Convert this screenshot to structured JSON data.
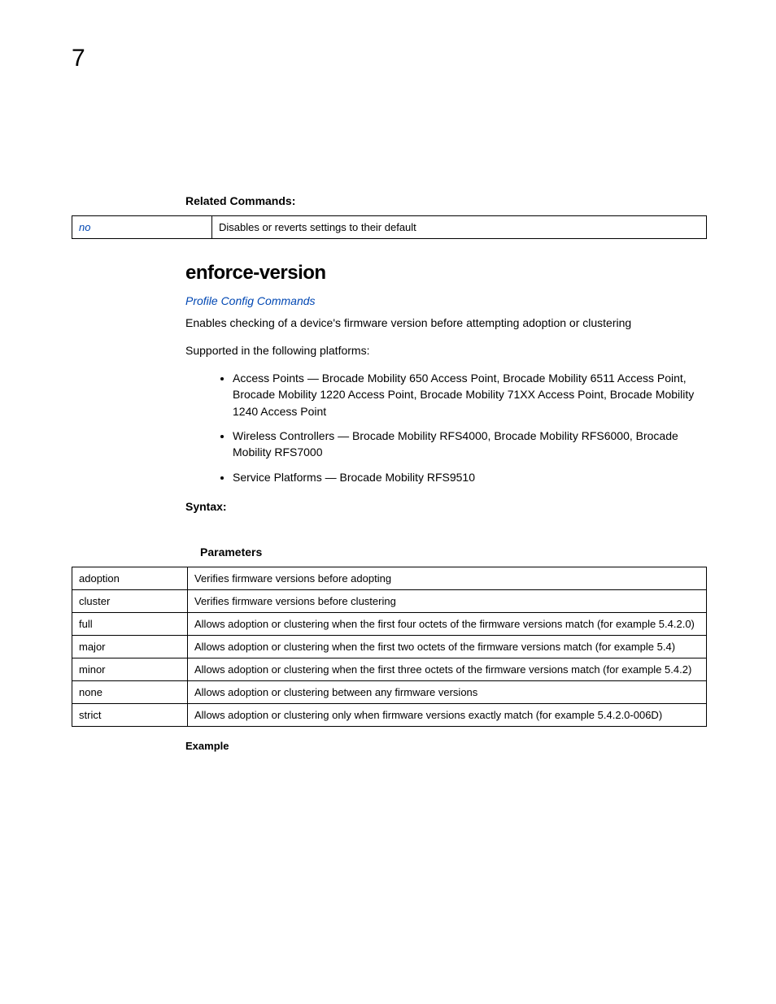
{
  "page_number": "7",
  "related_commands_heading": "Related Commands:",
  "related_commands": [
    {
      "name": "no",
      "desc": "Disables or reverts settings to their default"
    }
  ],
  "section_title": "enforce-version",
  "link": "Profile Config Commands",
  "description": "Enables checking of a device's firmware version before attempting adoption or clustering",
  "supported_platforms_intro": "Supported in the following platforms:",
  "platforms": [
    "Access Points — Brocade Mobility 650 Access Point, Brocade Mobility 6511 Access Point, Brocade Mobility 1220 Access Point, Brocade Mobility 71XX Access Point, Brocade Mobility 1240 Access Point",
    "Wireless Controllers — Brocade Mobility RFS4000, Brocade Mobility RFS6000, Brocade Mobility RFS7000",
    "Service Platforms — Brocade Mobility RFS9510"
  ],
  "syntax_label": "Syntax:",
  "parameters_label": "Parameters",
  "parameters": [
    {
      "name": "adoption",
      "desc": "Verifies firmware versions before adopting"
    },
    {
      "name": "cluster",
      "desc": "Verifies firmware versions before clustering"
    },
    {
      "name": "full",
      "desc": "Allows adoption or clustering when the first four octets of the firmware versions match (for example 5.4.2.0)"
    },
    {
      "name": "major",
      "desc": "Allows adoption or clustering when the first two octets of the firmware versions match (for example 5.4)"
    },
    {
      "name": "minor",
      "desc": "Allows adoption or clustering when the first three octets of the firmware versions match (for example 5.4.2)"
    },
    {
      "name": "none",
      "desc": "Allows adoption or clustering between any firmware versions"
    },
    {
      "name": "strict",
      "desc": "Allows adoption or clustering only when firmware versions exactly match (for example 5.4.2.0-006D)"
    }
  ],
  "example_label": "Example"
}
